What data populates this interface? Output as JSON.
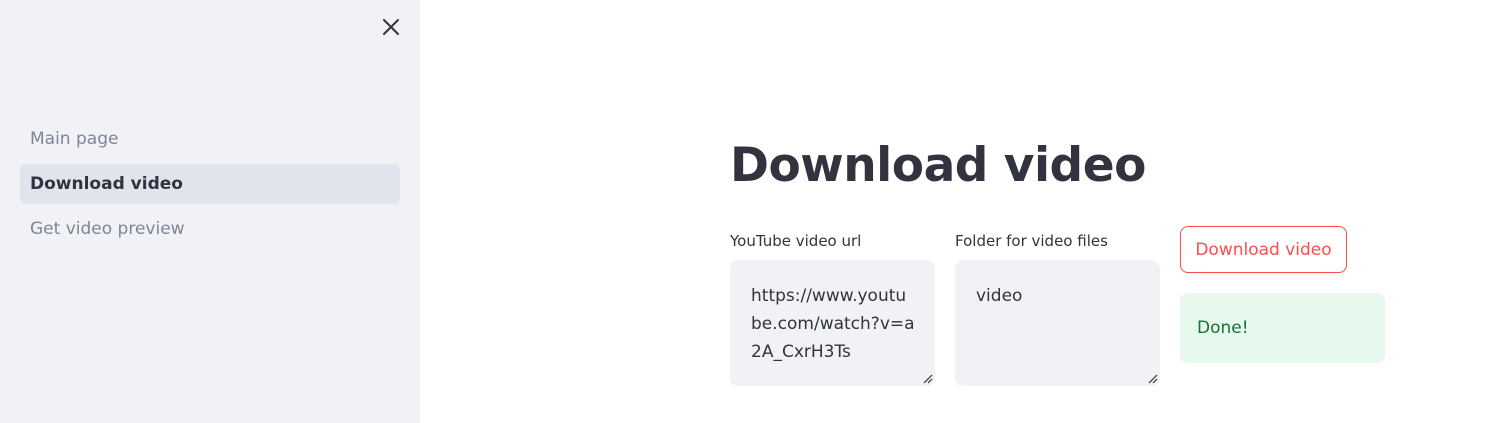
{
  "sidebar": {
    "close_icon": "close-icon",
    "items": [
      {
        "label": "Main page",
        "active": false
      },
      {
        "label": "Download video",
        "active": true
      },
      {
        "label": "Get video preview",
        "active": false
      }
    ]
  },
  "main": {
    "title": "Download video",
    "url_field": {
      "label": "YouTube video url",
      "value": "https://www.youtube.com/watch?v=a2A_CxrH3Ts"
    },
    "folder_field": {
      "label": "Folder for video files",
      "value": "video"
    },
    "download_button": {
      "label": "Download video"
    },
    "status": {
      "message": "Done!"
    }
  },
  "colors": {
    "sidebar_bg": "#f0f2f6",
    "active_item_bg": "#e0e4ec",
    "primary": "#ff4b4b",
    "success_bg": "#e6f9ec",
    "success_text": "#177233",
    "text": "#31333f",
    "muted_text": "#808495"
  }
}
